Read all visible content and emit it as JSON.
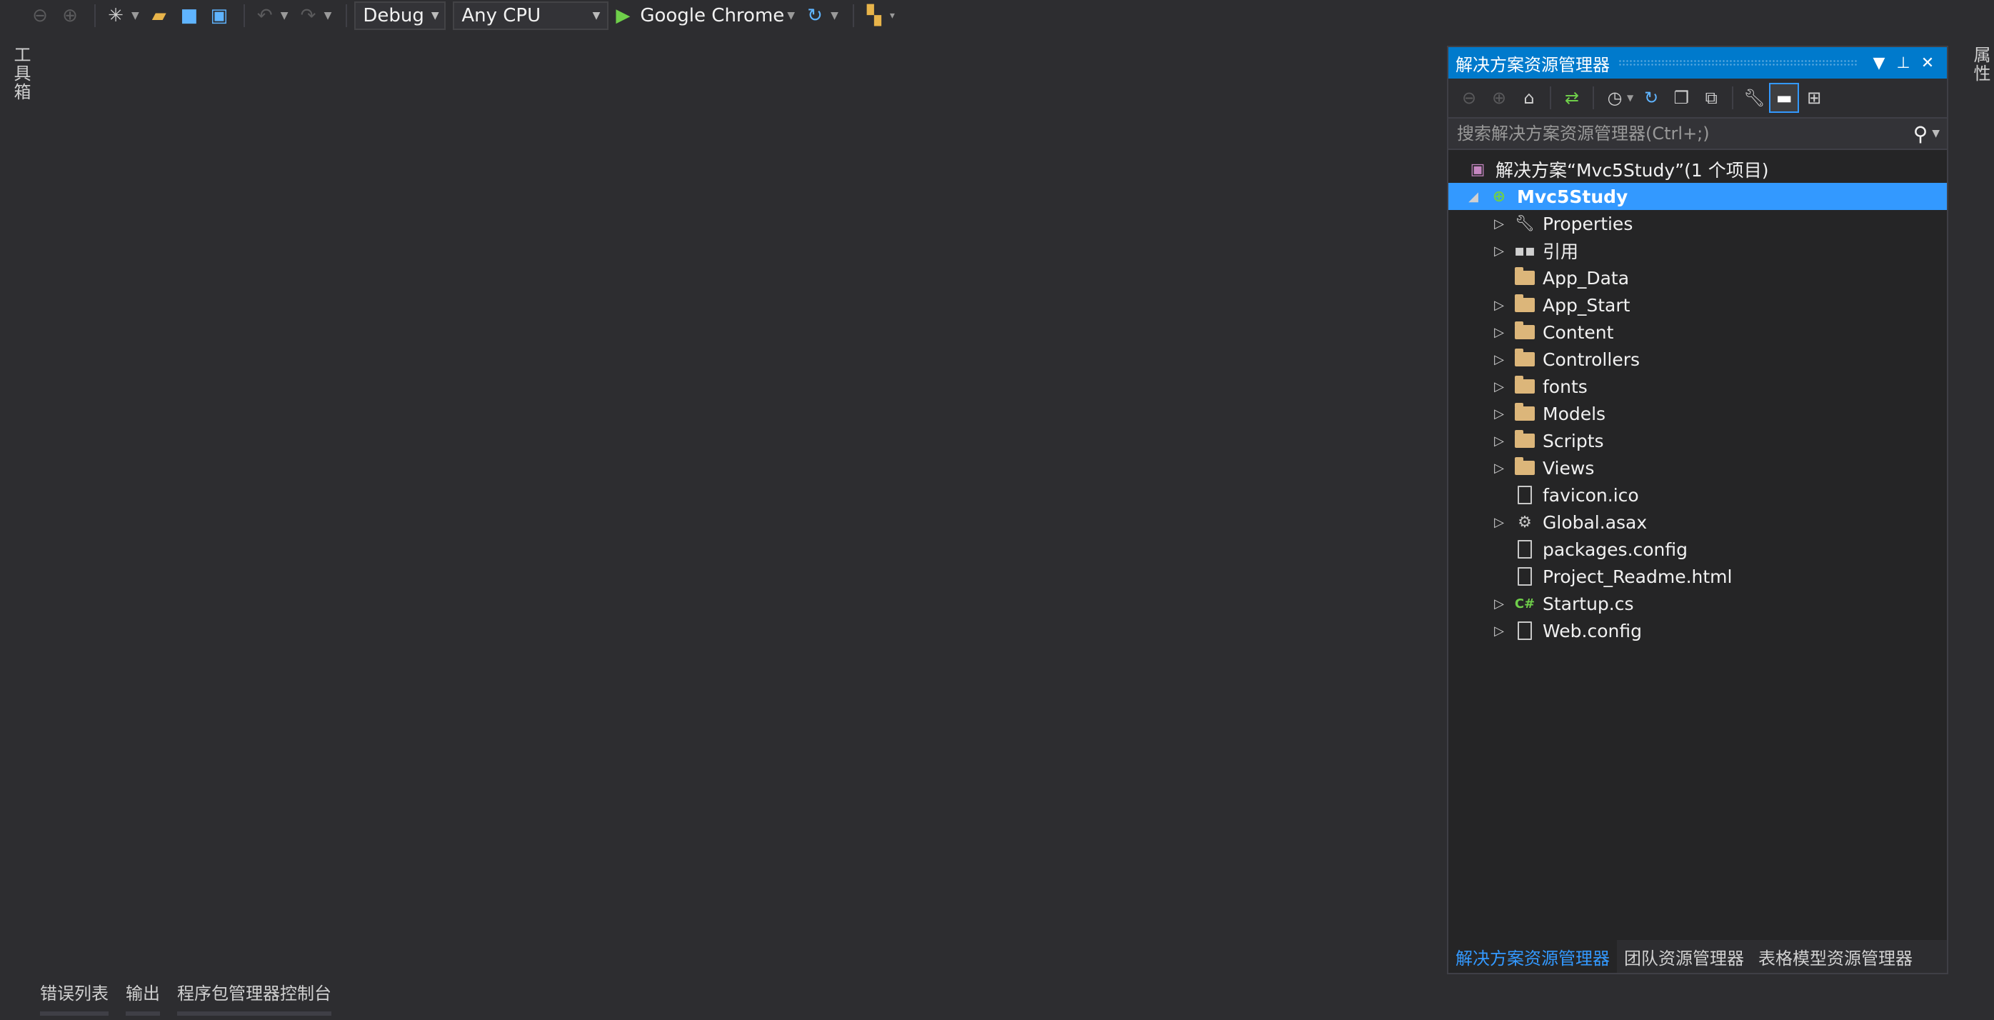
{
  "toolbar": {
    "config": "Debug",
    "platform": "Any CPU",
    "run_target": "Google Chrome",
    "icons": [
      "back-icon",
      "forward-icon",
      "new-project-icon",
      "open-file-icon",
      "save-icon",
      "save-all-icon",
      "undo-icon",
      "redo-icon",
      "run-icon",
      "refresh-icon",
      "find-in-files-icon"
    ]
  },
  "side_tabs": {
    "left": "工具箱",
    "right": "属性"
  },
  "solution_explorer": {
    "title": "解决方案资源管理器",
    "search_placeholder": "搜索解决方案资源管理器(Ctrl+;)",
    "tree": [
      {
        "label": "解决方案“Mvc5Study”(1 个项目)",
        "icon": "solution-icon"
      },
      {
        "label": "Mvc5Study",
        "icon": "web-project-icon",
        "selected": true
      },
      {
        "label": "Properties",
        "icon": "wrench-icon"
      },
      {
        "label": "引用",
        "icon": "references-icon"
      },
      {
        "label": "App_Data",
        "icon": "folder-icon"
      },
      {
        "label": "App_Start",
        "icon": "folder-icon"
      },
      {
        "label": "Content",
        "icon": "folder-icon"
      },
      {
        "label": "Controllers",
        "icon": "folder-icon"
      },
      {
        "label": "fonts",
        "icon": "folder-icon"
      },
      {
        "label": "Models",
        "icon": "folder-icon"
      },
      {
        "label": "Scripts",
        "icon": "folder-icon"
      },
      {
        "label": "Views",
        "icon": "folder-icon"
      },
      {
        "label": "favicon.ico",
        "icon": "file-icon"
      },
      {
        "label": "Global.asax",
        "icon": "global-asax-icon"
      },
      {
        "label": "packages.config",
        "icon": "config-file-icon"
      },
      {
        "label": "Project_Readme.html",
        "icon": "html-file-icon"
      },
      {
        "label": "Startup.cs",
        "icon": "csharp-file-icon"
      },
      {
        "label": "Web.config",
        "icon": "config-file-icon"
      }
    ],
    "tabs": [
      "解决方案资源管理器",
      "团队资源管理器",
      "表格模型资源管理器"
    ],
    "active_tab": 0
  },
  "bottom_tabs": [
    "错误列表",
    "输出",
    "程序包管理器控制台"
  ],
  "colors": {
    "accent": "#007acc",
    "selection": "#3399ff",
    "background": "#2d2d30",
    "panel": "#252526"
  }
}
